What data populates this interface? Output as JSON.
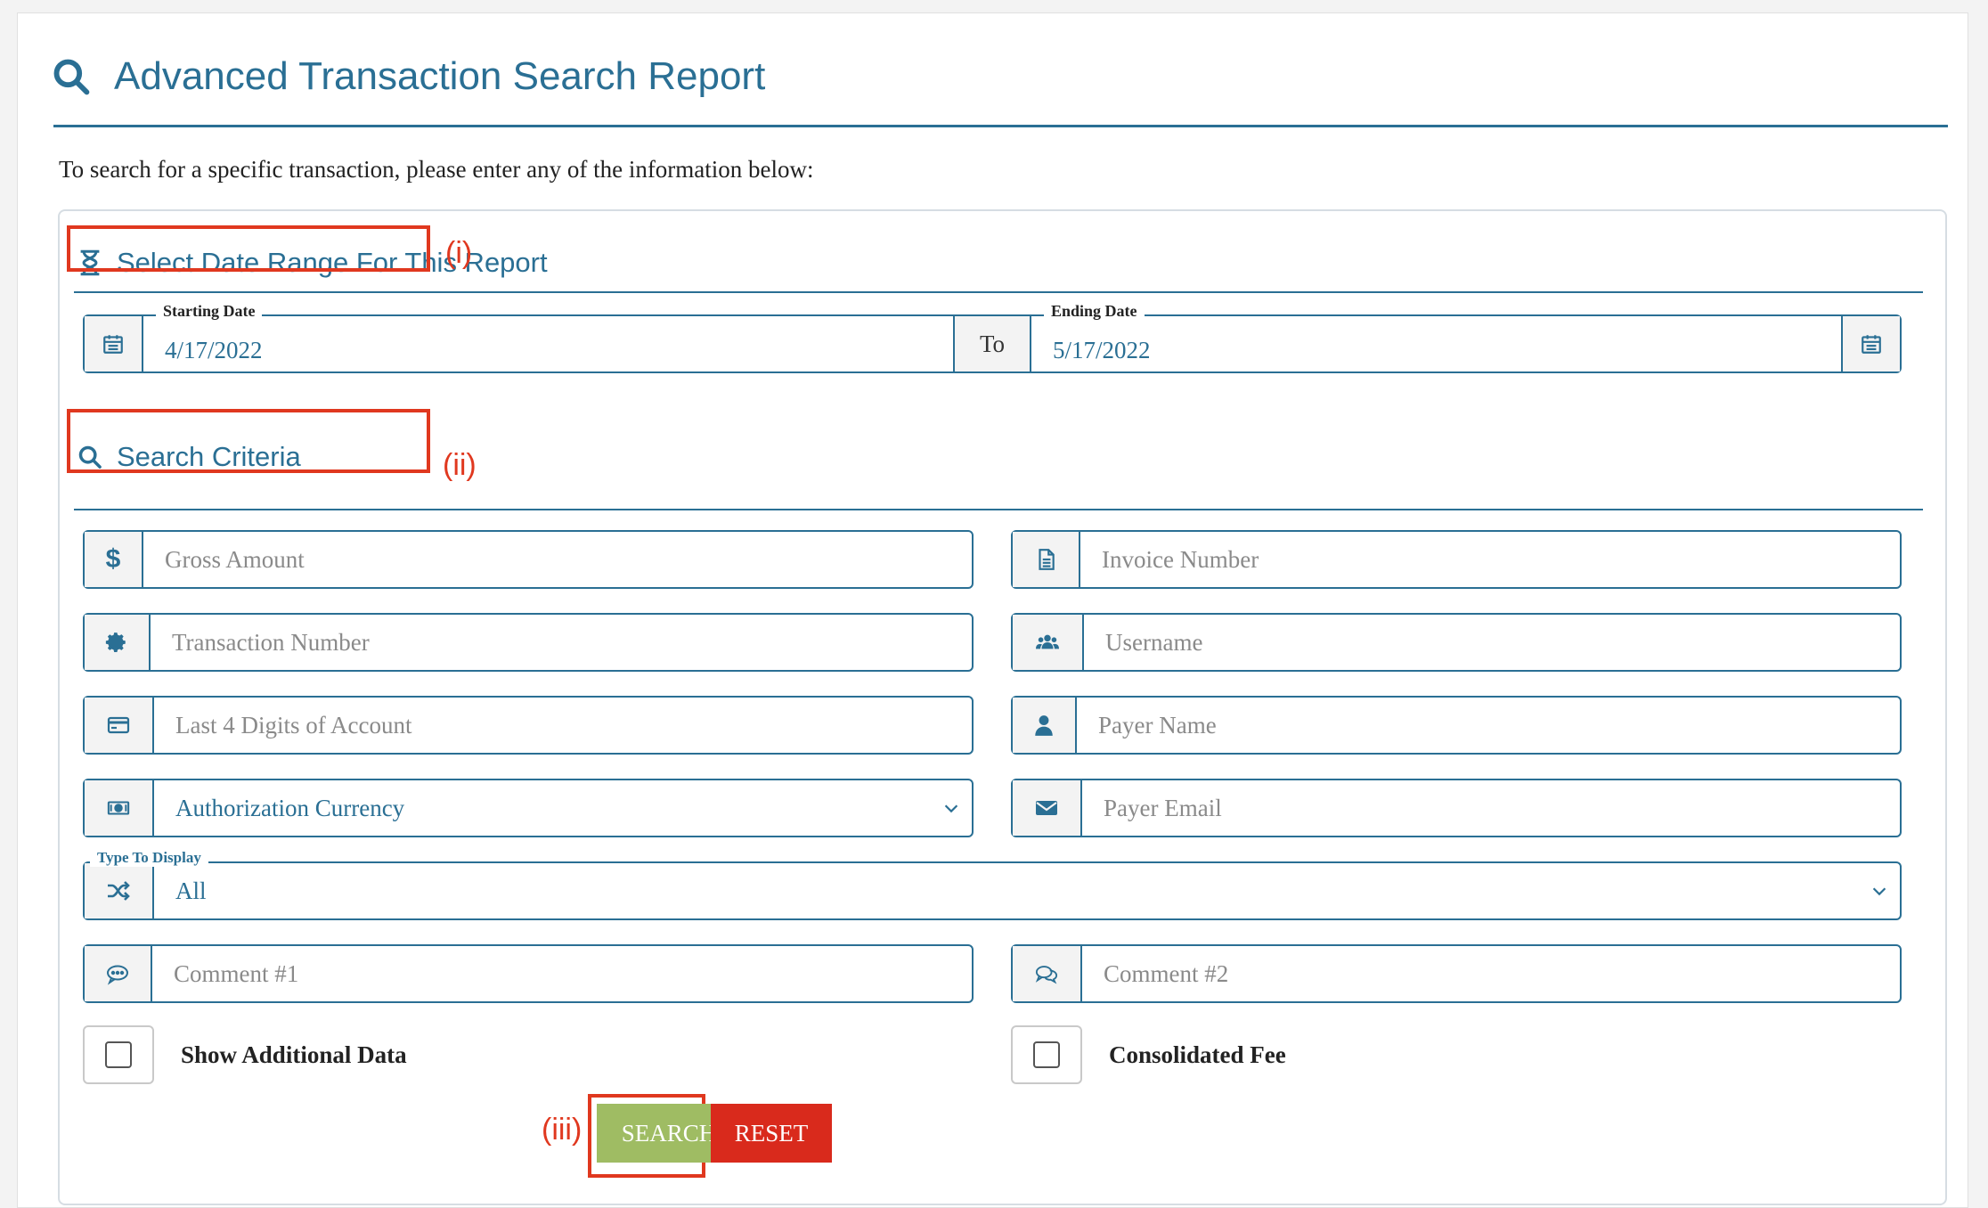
{
  "header": {
    "title": "Advanced Transaction Search Report"
  },
  "intro": "To search for a specific transaction, please enter any of the information below:",
  "date_section": {
    "heading": "Select Date Range For This Report",
    "annotation": "(i)",
    "start_label": "Starting Date",
    "start_value": "4/17/2022",
    "to_label": "To",
    "end_label": "Ending Date",
    "end_value": "5/17/2022"
  },
  "criteria_section": {
    "heading": "Search Criteria",
    "annotation": "(ii)",
    "fields": {
      "gross_amount": {
        "placeholder": "Gross Amount",
        "icon": "dollar-icon"
      },
      "invoice_number": {
        "placeholder": "Invoice Number",
        "icon": "document-icon"
      },
      "transaction_number": {
        "placeholder": "Transaction Number",
        "icon": "gear-icon"
      },
      "username": {
        "placeholder": "Username",
        "icon": "users-icon"
      },
      "last4": {
        "placeholder": "Last 4 Digits of Account",
        "icon": "credit-card-icon"
      },
      "payer_name": {
        "placeholder": "Payer Name",
        "icon": "user-icon"
      },
      "auth_currency": {
        "selected": "Authorization Currency",
        "icon": "money-icon"
      },
      "payer_email": {
        "placeholder": "Payer Email",
        "icon": "envelope-icon"
      },
      "type_to_display": {
        "label": "Type To Display",
        "selected": "All",
        "icon": "shuffle-icon"
      },
      "comment1": {
        "placeholder": "Comment #1",
        "icon": "comment-icon"
      },
      "comment2": {
        "placeholder": "Comment #2",
        "icon": "comments-icon"
      }
    },
    "checkboxes": {
      "show_additional": "Show Additional Data",
      "consolidated_fee": "Consolidated Fee"
    }
  },
  "actions": {
    "annotation": "(iii)",
    "search_label": "SEARCH",
    "reset_label": "RESET"
  },
  "colors": {
    "primary": "#2a6f94",
    "annotation_red": "#e0381f",
    "search_green": "#9fbc63",
    "reset_red": "#d92a1c"
  }
}
